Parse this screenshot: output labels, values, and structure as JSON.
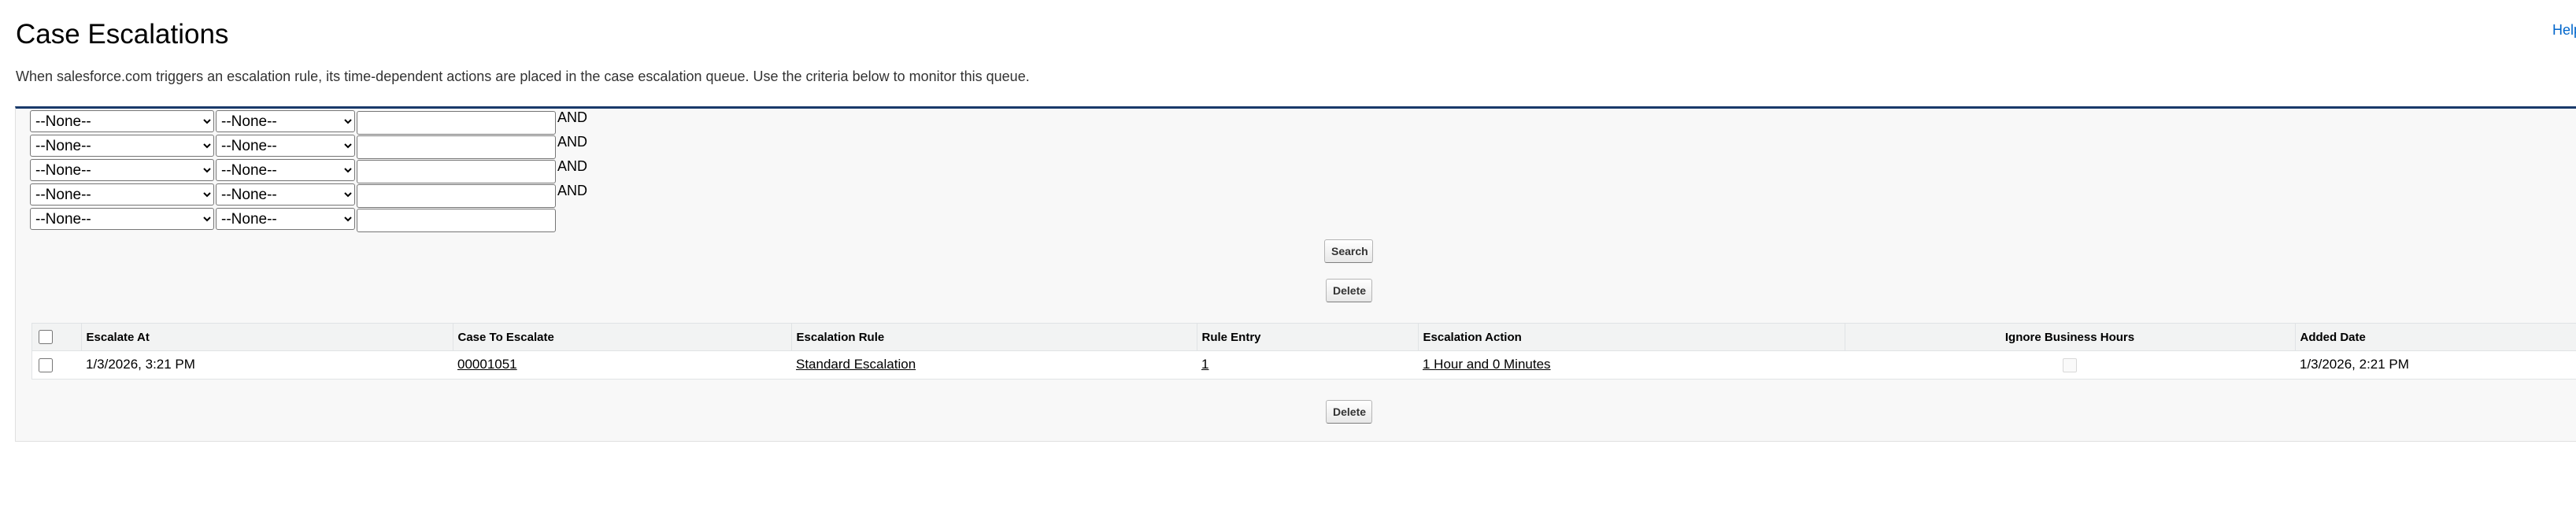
{
  "header": {
    "title": "Case Escalations",
    "help_link": "Help for this Page"
  },
  "description": "When salesforce.com triggers an escalation rule, its time-dependent actions are placed in the case escalation queue. Use the criteria below to monitor this queue.",
  "filters": {
    "field_default": "--None--",
    "operator_default": "--None--",
    "connector": "AND",
    "rows": [
      {
        "field": "--None--",
        "operator": "--None--",
        "value": "",
        "connector": "AND"
      },
      {
        "field": "--None--",
        "operator": "--None--",
        "value": "",
        "connector": "AND"
      },
      {
        "field": "--None--",
        "operator": "--None--",
        "value": "",
        "connector": "AND"
      },
      {
        "field": "--None--",
        "operator": "--None--",
        "value": "",
        "connector": "AND"
      },
      {
        "field": "--None--",
        "operator": "--None--",
        "value": "",
        "connector": ""
      }
    ]
  },
  "buttons": {
    "search": "Search",
    "delete": "Delete"
  },
  "table": {
    "headers": {
      "escalate_at": "Escalate At",
      "case_to_escalate": "Case To Escalate",
      "escalation_rule": "Escalation Rule",
      "rule_entry": "Rule Entry",
      "escalation_action": "Escalation Action",
      "ignore_business_hours": "Ignore Business Hours",
      "added_date": "Added Date"
    },
    "rows": [
      {
        "escalate_at": "1/3/2026, 3:21 PM",
        "case_to_escalate": "00001051",
        "escalation_rule": "Standard Escalation",
        "rule_entry": "1",
        "escalation_action": "1 Hour and 0 Minutes",
        "ignore_business_hours": false,
        "added_date": "1/3/2026, 2:21 PM"
      }
    ]
  },
  "colors": {
    "panel_border": "#1a3a6b",
    "link": "#0066cc",
    "panel_bg": "#f8f8f8"
  }
}
